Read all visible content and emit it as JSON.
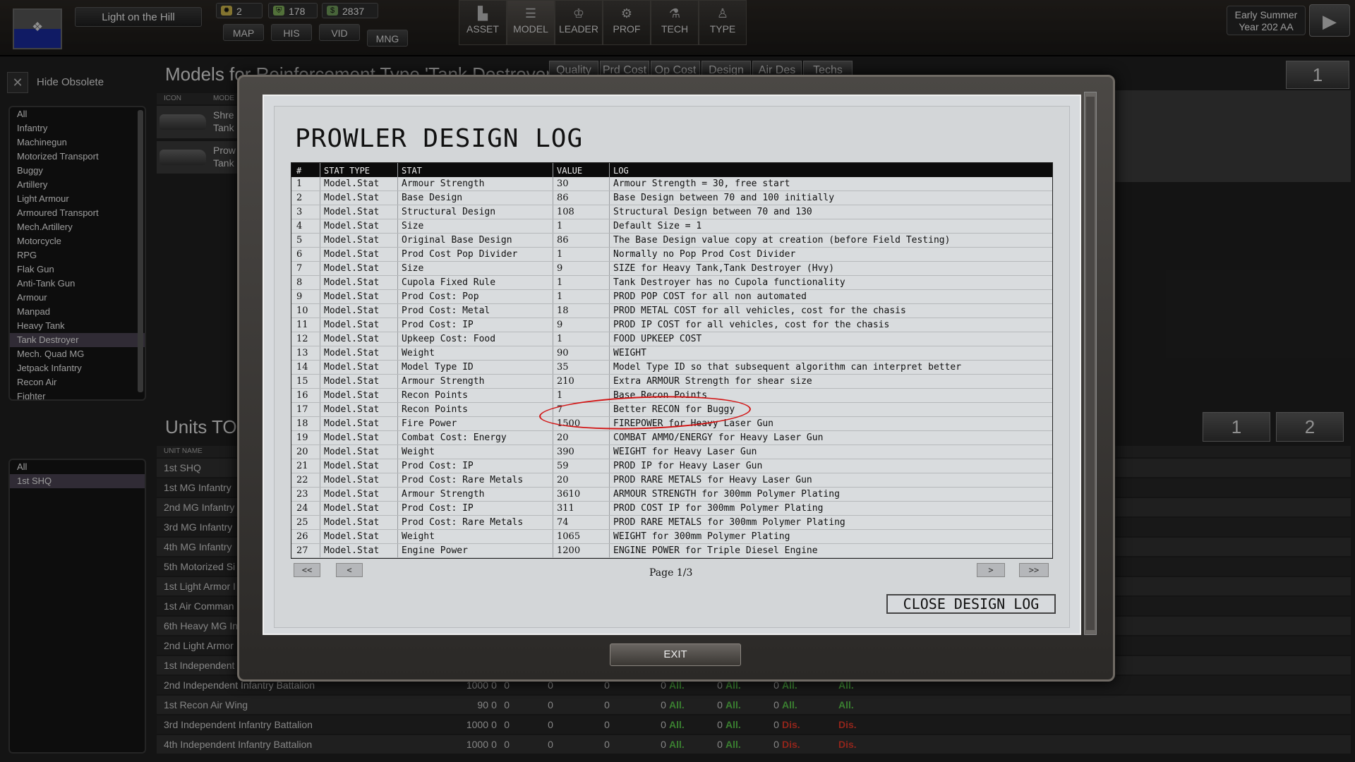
{
  "topbar": {
    "nation_name": "Light on the Hill",
    "resources": [
      {
        "icon": "sun-icon",
        "value": "2"
      },
      {
        "icon": "shield-icon",
        "value": "178"
      },
      {
        "icon": "cash-icon",
        "value": "2837"
      }
    ],
    "small_tabs": [
      "MAP",
      "HIS",
      "VID",
      "MNG"
    ],
    "big_tabs": [
      {
        "icon": "building-icon",
        "label": "ASSET"
      },
      {
        "icon": "database-icon",
        "label": "MODEL"
      },
      {
        "icon": "leader-icon",
        "label": "LEADER"
      },
      {
        "icon": "profile-icon",
        "label": "PROF"
      },
      {
        "icon": "tech-tree-icon",
        "label": "TECH"
      },
      {
        "icon": "soldier-icon",
        "label": "TYPE"
      }
    ],
    "date_line1": "Early Summer",
    "date_line2": "Year 202 AA",
    "next_turn_icon": "play-icon"
  },
  "left": {
    "hide_obsolete_label": "Hide Obsolete",
    "filter_items": [
      "All",
      "Infantry",
      "Machinegun",
      "Motorized Transport",
      "Buggy",
      "Artillery",
      "Light Armour",
      "Armoured Transport",
      "Mech.Artillery",
      "Motorcycle",
      "RPG",
      "Flak Gun",
      "Anti-Tank Gun",
      "Armour",
      "Manpad",
      "Heavy Tank",
      "Tank Destroyer",
      "Mech. Quad MG",
      "Jetpack Infantry",
      "Recon Air",
      "Fighter"
    ],
    "filter_selected": "Tank Destroyer",
    "unit_filter_items": [
      "All",
      "1st SHQ"
    ],
    "unit_filter_selected": "1st SHQ"
  },
  "main": {
    "models_title": "Models for Reinforcement Type 'Tank Destroyer'",
    "column_buttons": [
      "Quality",
      "Prd Cost",
      "Op Cost",
      "Design",
      "Air Des",
      "Techs"
    ],
    "models_header": {
      "icon": "ICON",
      "model": "MODE"
    },
    "models": [
      {
        "name": "Shre",
        "type": "Tank"
      },
      {
        "name": "Prow",
        "type": "Tank"
      }
    ],
    "models_page_button": "1",
    "units_title": "Units TO",
    "units_header": "UNIT NAME",
    "units_page_buttons": [
      "1",
      "2"
    ],
    "units": [
      {
        "name": "1st SHQ"
      },
      {
        "name": "1st MG Infantry"
      },
      {
        "name": "2nd MG Infantry"
      },
      {
        "name": "3rd MG Infantry"
      },
      {
        "name": "4th MG Infantry"
      },
      {
        "name": "5th Motorized Si"
      },
      {
        "name": "1st Light Armor I"
      },
      {
        "name": "1st Air Comman"
      },
      {
        "name": "6th Heavy MG In"
      },
      {
        "name": "2nd Light Armor"
      },
      {
        "name": "1st Independent"
      },
      {
        "name": "2nd Independent Infantry Battalion",
        "v1": "1000",
        "v2": "0",
        "z": [
          "0",
          "0",
          "0",
          "0",
          "0",
          "0"
        ],
        "s": [
          "All.",
          "All.",
          "All.",
          "All."
        ]
      },
      {
        "name": "1st Recon Air Wing",
        "v1": "90",
        "v2": "0",
        "z": [
          "0",
          "0",
          "0",
          "0",
          "0",
          "0"
        ],
        "s": [
          "All.",
          "All.",
          "All.",
          "All."
        ]
      },
      {
        "name": "3rd Independent Infantry Battalion",
        "v1": "1000",
        "v2": "0",
        "z": [
          "0",
          "0",
          "0",
          "0",
          "0",
          "0"
        ],
        "s": [
          "All.",
          "All.",
          "Dis.",
          "Dis."
        ]
      },
      {
        "name": "4th Independent Infantry Battalion",
        "v1": "1000",
        "v2": "0",
        "z": [
          "0",
          "0",
          "0",
          "0",
          "0",
          "0"
        ],
        "s": [
          "All.",
          "All.",
          "Dis.",
          "Dis."
        ]
      }
    ],
    "status_colors": {
      "all": "#59c34a",
      "dis": "#e03a2a"
    }
  },
  "modal": {
    "title": "PROWLER DESIGN LOG",
    "columns": [
      "#",
      "STAT TYPE",
      "STAT",
      "VALUE",
      "LOG"
    ],
    "rows": [
      [
        "1",
        "Model.Stat",
        "Armour Strength",
        "30",
        "Armour Strength = 30, free start"
      ],
      [
        "2",
        "Model.Stat",
        "Base Design",
        "86",
        "Base Design between 70 and 100 initially"
      ],
      [
        "3",
        "Model.Stat",
        "Structural Design",
        "108",
        "Structural Design between 70 and 130"
      ],
      [
        "4",
        "Model.Stat",
        "Size",
        "1",
        "Default Size = 1"
      ],
      [
        "5",
        "Model.Stat",
        "Original Base Design",
        "86",
        "The Base Design value copy at creation (before Field Testing)"
      ],
      [
        "6",
        "Model.Stat",
        "Prod Cost Pop Divider",
        "1",
        "Normally no Pop Prod Cost Divider"
      ],
      [
        "7",
        "Model.Stat",
        "Size",
        "9",
        "SIZE for Heavy Tank,Tank Destroyer (Hvy)"
      ],
      [
        "8",
        "Model.Stat",
        "Cupola Fixed Rule",
        "1",
        "Tank Destroyer has no Cupola functionality"
      ],
      [
        "9",
        "Model.Stat",
        "Prod Cost: Pop",
        "1",
        "PROD POP COST for all non automated"
      ],
      [
        "10",
        "Model.Stat",
        "Prod Cost: Metal",
        "18",
        "PROD METAL COST for all vehicles, cost for the chasis"
      ],
      [
        "11",
        "Model.Stat",
        "Prod Cost: IP",
        "9",
        "PROD IP COST for all vehicles, cost for the chasis"
      ],
      [
        "12",
        "Model.Stat",
        "Upkeep Cost: Food",
        "1",
        "FOOD UPKEEP COST"
      ],
      [
        "13",
        "Model.Stat",
        "Weight",
        "90",
        "WEIGHT"
      ],
      [
        "14",
        "Model.Stat",
        "Model Type ID",
        "35",
        "Model Type ID so that subsequent algorithm can interpret better"
      ],
      [
        "15",
        "Model.Stat",
        "Armour Strength",
        "210",
        "Extra ARMOUR Strength for shear size"
      ],
      [
        "16",
        "Model.Stat",
        "Recon Points",
        "1",
        "Base Recon Points"
      ],
      [
        "17",
        "Model.Stat",
        "Recon Points",
        "7",
        "Better RECON for Buggy"
      ],
      [
        "18",
        "Model.Stat",
        "Fire Power",
        "1500",
        "FIREPOWER for Heavy Laser Gun"
      ],
      [
        "19",
        "Model.Stat",
        "Combat Cost: Energy",
        "20",
        "COMBAT AMMO/ENERGY for Heavy Laser Gun"
      ],
      [
        "20",
        "Model.Stat",
        "Weight",
        "390",
        "WEIGHT for Heavy Laser Gun"
      ],
      [
        "21",
        "Model.Stat",
        "Prod Cost: IP",
        "59",
        "PROD IP for Heavy Laser Gun"
      ],
      [
        "22",
        "Model.Stat",
        "Prod Cost: Rare Metals",
        "20",
        "PROD RARE METALS for Heavy Laser Gun"
      ],
      [
        "23",
        "Model.Stat",
        "Armour Strength",
        "3610",
        "ARMOUR STRENGTH for 300mm Polymer Plating"
      ],
      [
        "24",
        "Model.Stat",
        "Prod Cost: IP",
        "311",
        "PROD COST IP for 300mm Polymer Plating"
      ],
      [
        "25",
        "Model.Stat",
        "Prod Cost: Rare Metals",
        "74",
        "PROD RARE METALS for 300mm Polymer Plating"
      ],
      [
        "26",
        "Model.Stat",
        "Weight",
        "1065",
        "WEIGHT for 300mm Polymer Plating"
      ],
      [
        "27",
        "Model.Stat",
        "Engine Power",
        "1200",
        "ENGINE POWER for Triple Diesel Engine"
      ]
    ],
    "nav": {
      "first": "<<",
      "prev": "<",
      "next": ">",
      "last": ">>"
    },
    "page_label": "Page 1/3",
    "close_label": "CLOSE DESIGN LOG",
    "highlight_color": "#d21414"
  },
  "exit_label": "EXIT"
}
